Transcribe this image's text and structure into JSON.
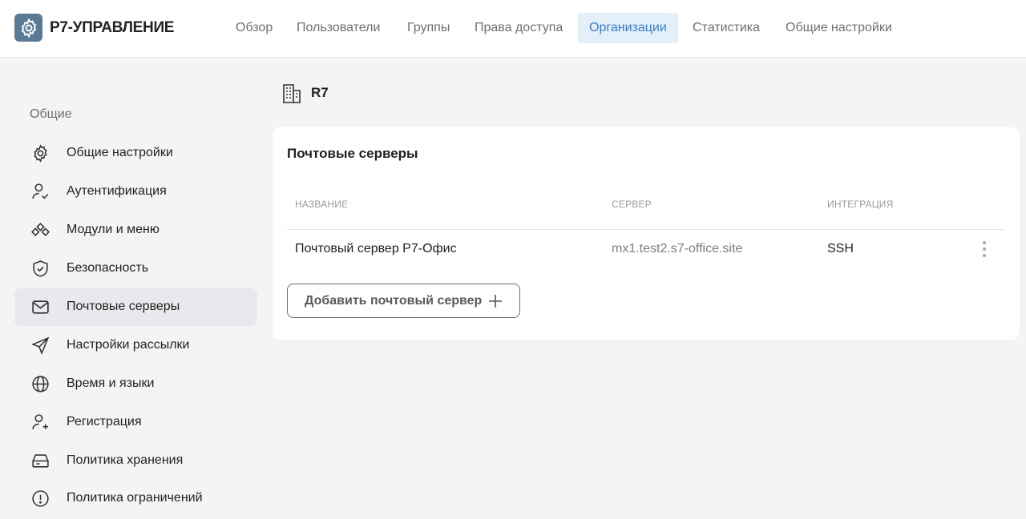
{
  "app": {
    "brand": "Р7-УПРАВЛЕНИЕ",
    "logo_icon": "gear-logo-icon",
    "accent_color": "#3a7fc2"
  },
  "nav": {
    "tabs": [
      {
        "label": "Обзор",
        "active": false
      },
      {
        "label": "Пользователи",
        "active": false
      },
      {
        "label": "Группы",
        "active": false
      },
      {
        "label": "Права доступа",
        "active": false
      },
      {
        "label": "Организации",
        "active": true
      },
      {
        "label": "Статистика",
        "active": false
      },
      {
        "label": "Общие настройки",
        "active": false
      }
    ]
  },
  "sidebar": {
    "heading": "Общие",
    "items": [
      {
        "label": "Общие настройки",
        "icon": "gear-icon",
        "active": false
      },
      {
        "label": "Аутентификация",
        "icon": "user-check-icon",
        "active": false
      },
      {
        "label": "Модули и меню",
        "icon": "modules-icon",
        "active": false
      },
      {
        "label": "Безопасность",
        "icon": "shield-icon",
        "active": false
      },
      {
        "label": "Почтовые серверы",
        "icon": "mail-icon",
        "active": true
      },
      {
        "label": "Настройки рассылки",
        "icon": "send-icon",
        "active": false
      },
      {
        "label": "Время и языки",
        "icon": "globe-icon",
        "active": false
      },
      {
        "label": "Регистрация",
        "icon": "user-plus-icon",
        "active": false
      },
      {
        "label": "Политика хранения",
        "icon": "storage-icon",
        "active": false
      },
      {
        "label": "Политика ограничений",
        "icon": "alert-circle-icon",
        "active": false
      }
    ]
  },
  "org": {
    "name": "R7",
    "icon": "building-icon"
  },
  "mail_servers": {
    "title": "Почтовые серверы",
    "columns": {
      "name": "Название",
      "server": "Сервер",
      "integration": "Интеграция"
    },
    "rows": [
      {
        "name": "Почтовый сервер Р7-Офис",
        "server": "mx1.test2.s7-office.site",
        "integration": "SSH"
      }
    ],
    "add_button": "Добавить почтовый сервер"
  }
}
